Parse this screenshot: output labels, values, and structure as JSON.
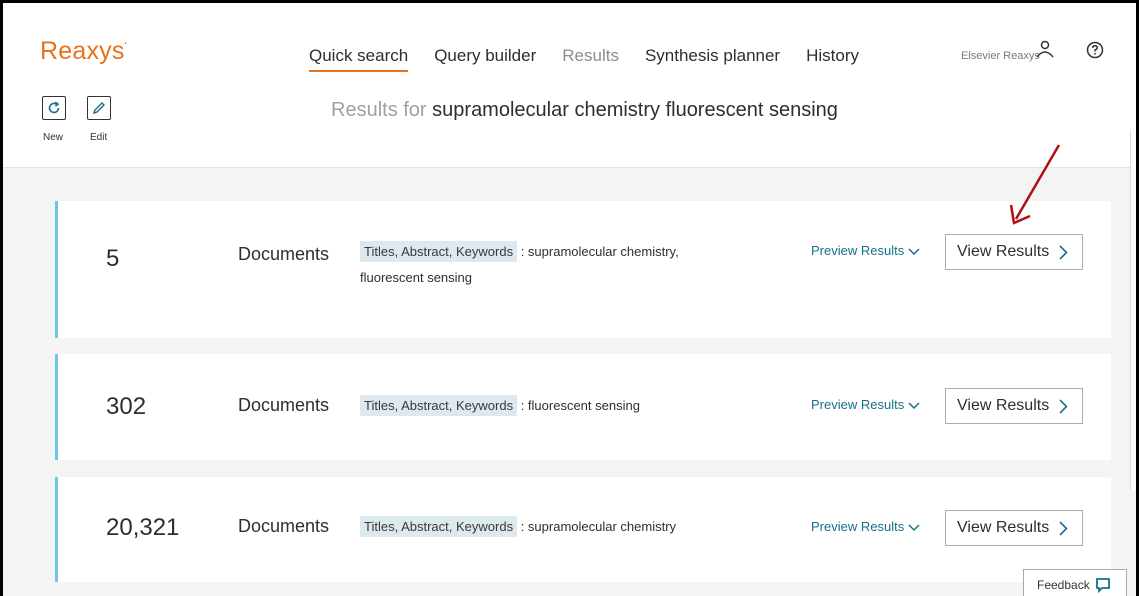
{
  "app": {
    "logo": "Reaxys",
    "logo_mark": "'"
  },
  "nav": {
    "items": [
      {
        "label": "Quick search",
        "state": "active"
      },
      {
        "label": "Query builder",
        "state": "normal"
      },
      {
        "label": "Results",
        "state": "dim"
      },
      {
        "label": "Synthesis planner",
        "state": "normal"
      },
      {
        "label": "History",
        "state": "normal"
      }
    ]
  },
  "user": {
    "name": "Elsevier Reaxys",
    "icon": "user-icon",
    "help_icon": "help-icon"
  },
  "toolbar": {
    "new_label": "New",
    "edit_label": "Edit",
    "new_icon": "refresh-icon",
    "edit_icon": "pencil-icon"
  },
  "results": {
    "prefix": "Results for",
    "query": "supramolecular chemistry fluorescent sensing"
  },
  "cards": [
    {
      "count": "5",
      "type": "Documents",
      "tag": "Titles, Abstract, Keywords",
      "terms": ": supramolecular chemistry, fluorescent sensing",
      "preview": "Preview Results",
      "view": "View Results"
    },
    {
      "count": "302",
      "type": "Documents",
      "tag": "Titles, Abstract, Keywords",
      "terms": ": fluorescent sensing",
      "preview": "Preview Results",
      "view": "View Results"
    },
    {
      "count": "20,321",
      "type": "Documents",
      "tag": "Titles, Abstract, Keywords",
      "terms": ": supramolecular chemistry",
      "preview": "Preview Results",
      "view": "View Results"
    }
  ],
  "feedback": {
    "label": "Feedback",
    "icon": "speech-bubble-icon"
  },
  "colors": {
    "accent": "#e9711c",
    "link": "#17708c",
    "card_border": "#6ec6e3",
    "annotation_arrow": "#b01010"
  }
}
